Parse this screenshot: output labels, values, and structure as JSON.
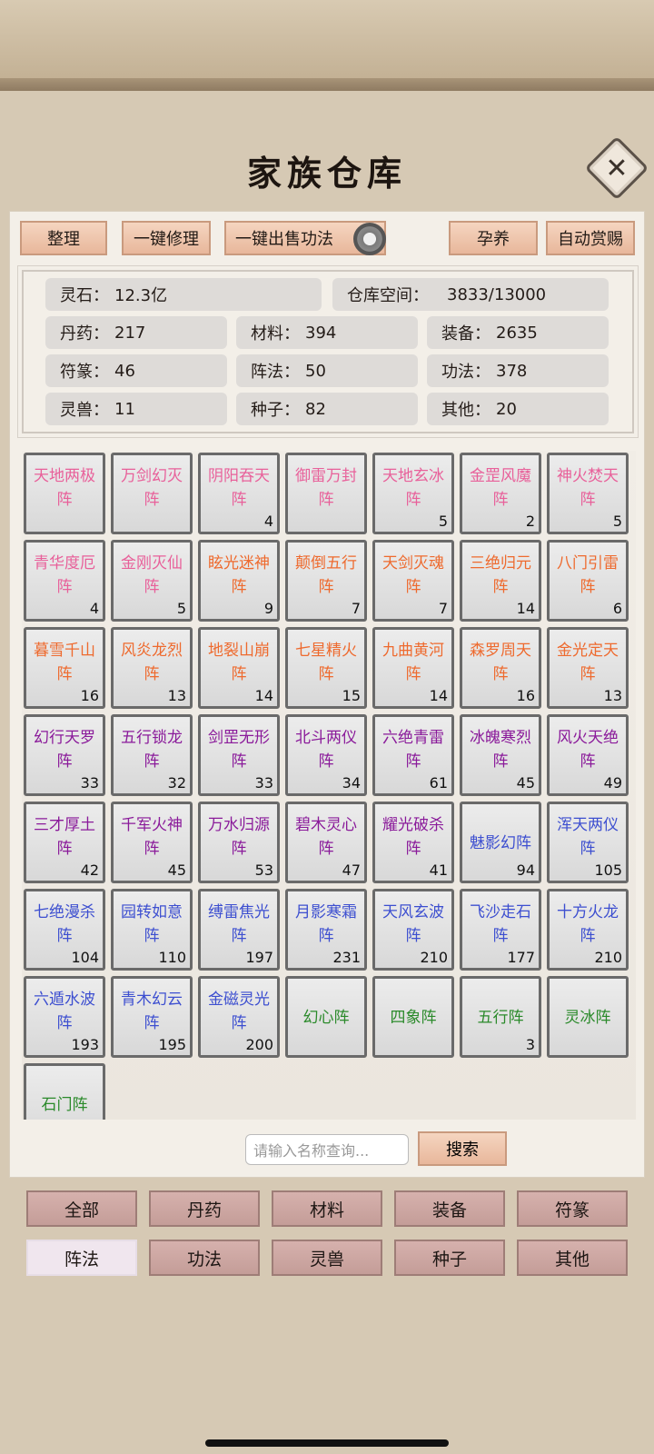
{
  "title": "家族仓库",
  "toolbar": {
    "organize": "整理",
    "repair_all": "一键修理",
    "sell_techniques": "一键出售功法",
    "nurture": "孕养",
    "auto_reward": "自动赏赐"
  },
  "stats": {
    "spirit_stone": {
      "label": "灵石：",
      "value": "12.3亿"
    },
    "storage": {
      "label": "仓库空间：",
      "value": "3833/13000"
    },
    "pills": {
      "label": "丹药：",
      "value": "217"
    },
    "materials": {
      "label": "材料：",
      "value": "394"
    },
    "equipment": {
      "label": "装备：",
      "value": "2635"
    },
    "talismans": {
      "label": "符篆：",
      "value": "46"
    },
    "formations": {
      "label": "阵法：",
      "value": "50"
    },
    "techniques": {
      "label": "功法：",
      "value": "378"
    },
    "beasts": {
      "label": "灵兽：",
      "value": "11"
    },
    "seeds": {
      "label": "种子：",
      "value": "82"
    },
    "others": {
      "label": "其他：",
      "value": "20"
    }
  },
  "items": [
    {
      "name": "天地两极阵",
      "count": "",
      "color": "#e8609a"
    },
    {
      "name": "万剑幻灭阵",
      "count": "",
      "color": "#e8609a"
    },
    {
      "name": "阴阳吞天阵",
      "count": "4",
      "color": "#e8609a"
    },
    {
      "name": "御雷万封阵",
      "count": "",
      "color": "#e8609a"
    },
    {
      "name": "天地玄冰阵",
      "count": "5",
      "color": "#e8609a"
    },
    {
      "name": "金罡风魔阵",
      "count": "2",
      "color": "#e8609a"
    },
    {
      "name": "神火焚天阵",
      "count": "5",
      "color": "#e8609a"
    },
    {
      "name": "青华度厄阵",
      "count": "4",
      "color": "#e8609a"
    },
    {
      "name": "金刚灭仙阵",
      "count": "5",
      "color": "#e8609a"
    },
    {
      "name": "眩光迷神阵",
      "count": "9",
      "color": "#ee6a2e"
    },
    {
      "name": "颠倒五行阵",
      "count": "7",
      "color": "#ee6a2e"
    },
    {
      "name": "天剑灭魂阵",
      "count": "7",
      "color": "#ee6a2e"
    },
    {
      "name": "三绝归元阵",
      "count": "14",
      "color": "#ee6a2e"
    },
    {
      "name": "八门引雷阵",
      "count": "6",
      "color": "#ee6a2e"
    },
    {
      "name": "暮雪千山阵",
      "count": "16",
      "color": "#ee6a2e"
    },
    {
      "name": "风炎龙烈阵",
      "count": "13",
      "color": "#ee6a2e"
    },
    {
      "name": "地裂山崩阵",
      "count": "14",
      "color": "#ee6a2e"
    },
    {
      "name": "七星精火阵",
      "count": "15",
      "color": "#ee6a2e"
    },
    {
      "name": "九曲黄河阵",
      "count": "14",
      "color": "#ee6a2e"
    },
    {
      "name": "森罗周天阵",
      "count": "16",
      "color": "#ee6a2e"
    },
    {
      "name": "金光定天阵",
      "count": "13",
      "color": "#ee6a2e"
    },
    {
      "name": "幻行天罗阵",
      "count": "33",
      "color": "#8a1a9a"
    },
    {
      "name": "五行锁龙阵",
      "count": "32",
      "color": "#8a1a9a"
    },
    {
      "name": "剑罡无形阵",
      "count": "33",
      "color": "#8a1a9a"
    },
    {
      "name": "北斗两仪阵",
      "count": "34",
      "color": "#8a1a9a"
    },
    {
      "name": "六绝青雷阵",
      "count": "61",
      "color": "#8a1a9a"
    },
    {
      "name": "冰魄寒烈阵",
      "count": "45",
      "color": "#8a1a9a"
    },
    {
      "name": "风火天绝阵",
      "count": "49",
      "color": "#8a1a9a"
    },
    {
      "name": "三才厚土阵",
      "count": "42",
      "color": "#8a1a9a"
    },
    {
      "name": "千军火神阵",
      "count": "45",
      "color": "#8a1a9a"
    },
    {
      "name": "万水归源阵",
      "count": "53",
      "color": "#8a1a9a"
    },
    {
      "name": "碧木灵心阵",
      "count": "47",
      "color": "#8a1a9a"
    },
    {
      "name": "耀光破杀阵",
      "count": "41",
      "color": "#8a1a9a"
    },
    {
      "name": "魅影幻阵",
      "count": "94",
      "color": "#3d4fd0"
    },
    {
      "name": "浑天两仪阵",
      "count": "105",
      "color": "#3d4fd0"
    },
    {
      "name": "七绝漫杀阵",
      "count": "104",
      "color": "#3d4fd0"
    },
    {
      "name": "园转如意阵",
      "count": "110",
      "color": "#3d4fd0"
    },
    {
      "name": "缚雷焦光阵",
      "count": "197",
      "color": "#3d4fd0"
    },
    {
      "name": "月影寒霜阵",
      "count": "231",
      "color": "#3d4fd0"
    },
    {
      "name": "天风玄波阵",
      "count": "210",
      "color": "#3d4fd0"
    },
    {
      "name": "飞沙走石阵",
      "count": "177",
      "color": "#3d4fd0"
    },
    {
      "name": "十方火龙阵",
      "count": "210",
      "color": "#3d4fd0"
    },
    {
      "name": "六遁水波阵",
      "count": "193",
      "color": "#3d4fd0"
    },
    {
      "name": "青木幻云阵",
      "count": "195",
      "color": "#3d4fd0"
    },
    {
      "name": "金磁灵光阵",
      "count": "200",
      "color": "#3d4fd0"
    },
    {
      "name": "幻心阵",
      "count": "",
      "color": "#2b8a2b"
    },
    {
      "name": "四象阵",
      "count": "",
      "color": "#2b8a2b"
    },
    {
      "name": "五行阵",
      "count": "3",
      "color": "#2b8a2b"
    },
    {
      "name": "灵冰阵",
      "count": "",
      "color": "#2b8a2b"
    },
    {
      "name": "石门阵",
      "count": "",
      "color": "#2b8a2b"
    }
  ],
  "search": {
    "placeholder": "请输入名称查询...",
    "button": "搜索"
  },
  "categories": [
    {
      "label": "全部",
      "active": false
    },
    {
      "label": "丹药",
      "active": false
    },
    {
      "label": "材料",
      "active": false
    },
    {
      "label": "装备",
      "active": false
    },
    {
      "label": "符篆",
      "active": false
    },
    {
      "label": "阵法",
      "active": true
    },
    {
      "label": "功法",
      "active": false
    },
    {
      "label": "灵兽",
      "active": false
    },
    {
      "label": "种子",
      "active": false
    },
    {
      "label": "其他",
      "active": false
    }
  ],
  "icons": {
    "close": "close-icon",
    "gear": "gear-icon"
  }
}
